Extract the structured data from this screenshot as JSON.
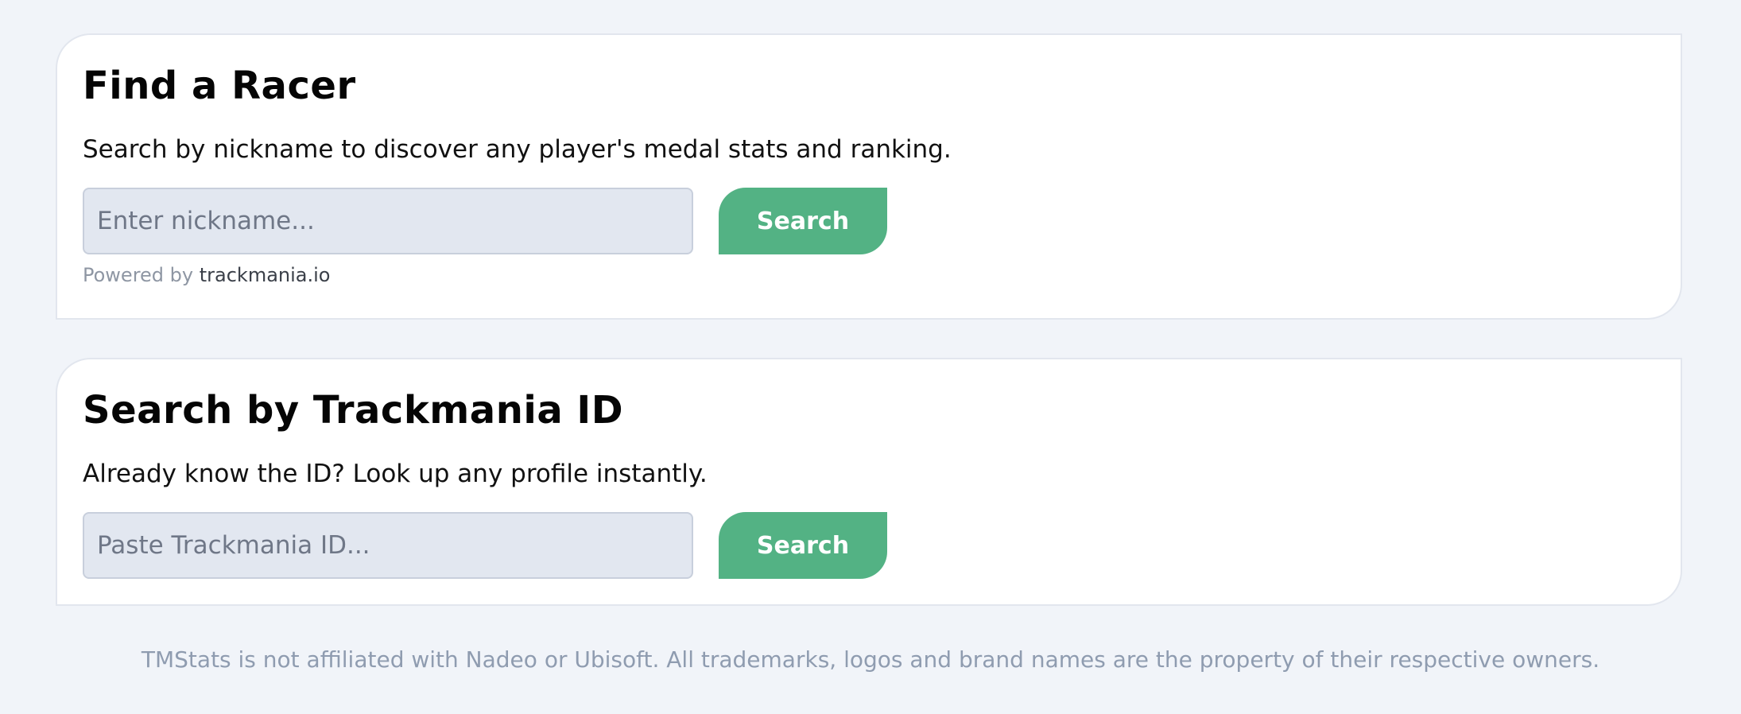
{
  "find_racer": {
    "title": "Find a Racer",
    "description": "Search by nickname to discover any player's medal stats and ranking.",
    "input_placeholder": "Enter nickname...",
    "input_value": "",
    "button_label": "Search",
    "powered_prefix": "Powered by",
    "powered_link": "trackmania.io"
  },
  "id_search": {
    "title": "Search by Trackmania ID",
    "description": "Already know the ID? Look up any profile instantly.",
    "input_placeholder": "Paste Trackmania ID...",
    "input_value": "",
    "button_label": "Search"
  },
  "footer": {
    "disclaimer": "TMStats is not affiliated with Nadeo or Ubisoft. All trademarks, logos and brand names are the property of their respective owners."
  },
  "colors": {
    "background": "#f1f4f9",
    "card": "#ffffff",
    "accent": "#53b284",
    "input_bg": "#e2e7f0",
    "muted_text": "#8f9cb0"
  }
}
